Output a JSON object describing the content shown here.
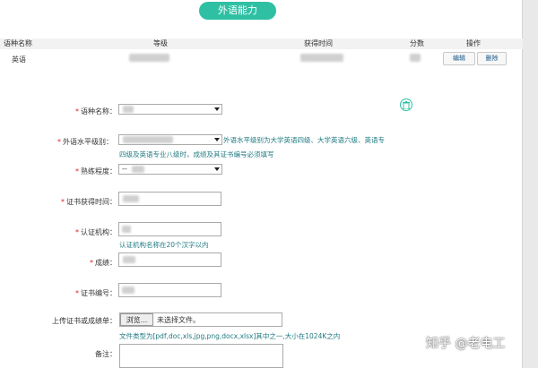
{
  "section": {
    "title": "外语能力"
  },
  "table": {
    "headers": [
      "语种名称",
      "等级",
      "获得时间",
      "分数",
      "操作"
    ],
    "rows": [
      {
        "language": "英语"
      }
    ],
    "edit_label": "编辑",
    "delete_label": "删除"
  },
  "form": {
    "language_label": "语种名称：",
    "level_label": "外语水平级别：",
    "level_hint_1": "外语水平级别为大学英语四级、大学英语六级、英语专",
    "level_hint_2": "四级及英语专业八级时，成绩及其证书编号必须填写",
    "proficiency_label": "熟练程度：",
    "proficiency_value": "--",
    "cert_time_label": "证书获得时间：",
    "issuer_label": "认证机构：",
    "issuer_hint": "认证机构名称在20个汉字以内",
    "score_label": "成绩：",
    "cert_no_label": "证书编号：",
    "upload_label": "上传证书或成绩单：",
    "browse_label": "浏览...",
    "no_file_text": "未选择文件。",
    "file_hint": "文件类型为[pdf,doc,xls,jpg,png,docx,xlsx]其中之一,大小在1024K之内",
    "remark_label": "备注："
  },
  "watermark": {
    "text": "知乎 @老电工"
  },
  "colors": {
    "accent": "#2fc0a3",
    "hint": "#1f7a82",
    "required": "#e02020"
  },
  "icons": {
    "delete_form": "trash-icon"
  }
}
